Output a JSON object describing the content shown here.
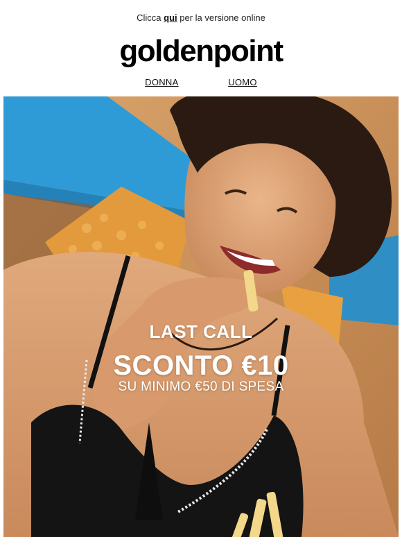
{
  "preheader": {
    "prefix": "Clicca ",
    "link": "qui",
    "suffix": " per la versione online"
  },
  "brand": {
    "logo_text": "goldenpoint"
  },
  "nav": {
    "items": [
      {
        "label": "DONNA"
      },
      {
        "label": "UOMO"
      }
    ]
  },
  "hero": {
    "headline": "LAST CALL",
    "offer": "SCONTO €10",
    "condition": "SU MINIMO €50 DI SPESA"
  },
  "colors": {
    "text": "#111111",
    "overlay_text": "#ffffff",
    "hero_blue": "#2f9bd6",
    "hero_warm": "#c98f58"
  }
}
